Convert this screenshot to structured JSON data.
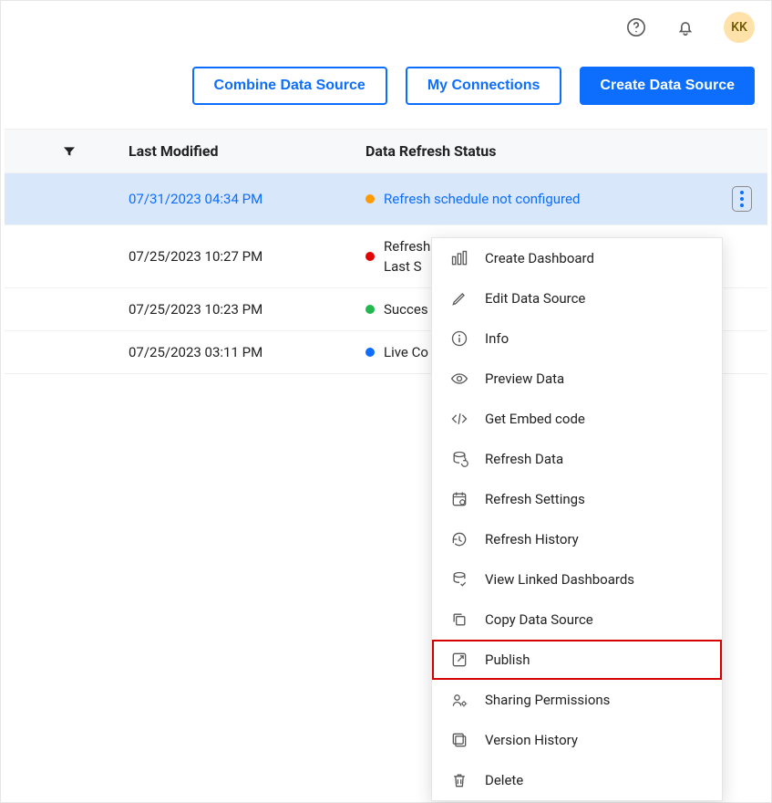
{
  "header": {
    "avatar_initials": "KK"
  },
  "actions": {
    "combine": "Combine Data Source",
    "connections": "My Connections",
    "create": "Create Data Source"
  },
  "table": {
    "columns": {
      "last_modified": "Last Modified",
      "refresh_status": "Data Refresh Status"
    },
    "rows": [
      {
        "modified": "07/31/2023 04:34 PM",
        "status_color": "orange",
        "status_text": "Refresh schedule not configured",
        "status_line2": "",
        "selected": true,
        "show_kebab": true
      },
      {
        "modified": "07/25/2023 10:27 PM",
        "status_color": "red",
        "status_text": "Refresh",
        "status_line2": "Last S",
        "selected": false,
        "show_kebab": false
      },
      {
        "modified": "07/25/2023 10:23 PM",
        "status_color": "green",
        "status_text": "Succes",
        "status_line2": "",
        "selected": false,
        "show_kebab": false
      },
      {
        "modified": "07/25/2023 03:11 PM",
        "status_color": "blue",
        "status_text": "Live Co",
        "status_line2": "",
        "selected": false,
        "show_kebab": false
      }
    ]
  },
  "context_menu": {
    "items": [
      {
        "icon": "dashboard-icon",
        "label": "Create Dashboard",
        "highlight": false
      },
      {
        "icon": "edit-icon",
        "label": "Edit Data Source",
        "highlight": false
      },
      {
        "icon": "info-icon",
        "label": "Info",
        "highlight": false
      },
      {
        "icon": "preview-icon",
        "label": "Preview Data",
        "highlight": false
      },
      {
        "icon": "code-icon",
        "label": "Get Embed code",
        "highlight": false
      },
      {
        "icon": "refresh-data-icon",
        "label": "Refresh Data",
        "highlight": false
      },
      {
        "icon": "refresh-settings-icon",
        "label": "Refresh Settings",
        "highlight": false
      },
      {
        "icon": "history-icon",
        "label": "Refresh History",
        "highlight": false
      },
      {
        "icon": "linked-icon",
        "label": "View Linked Dashboards",
        "highlight": false
      },
      {
        "icon": "copy-icon",
        "label": "Copy Data Source",
        "highlight": false
      },
      {
        "icon": "publish-icon",
        "label": "Publish",
        "highlight": true
      },
      {
        "icon": "share-icon",
        "label": "Sharing Permissions",
        "highlight": false
      },
      {
        "icon": "version-icon",
        "label": "Version History",
        "highlight": false
      },
      {
        "icon": "delete-icon",
        "label": "Delete",
        "highlight": false
      }
    ]
  }
}
